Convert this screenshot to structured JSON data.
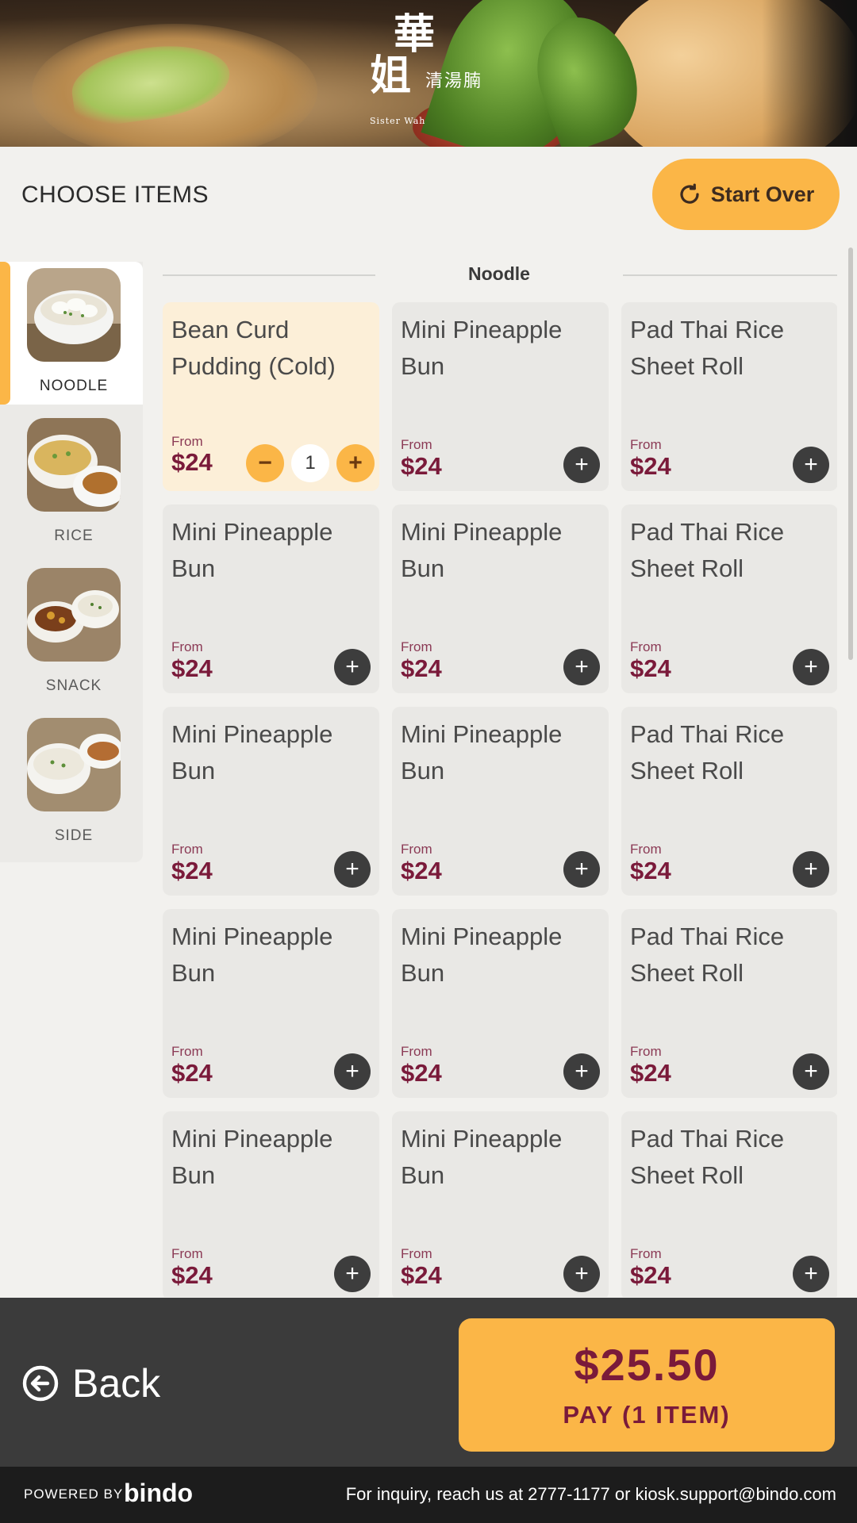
{
  "brand": {
    "logo_chars_top": "華",
    "logo_chars_bottom": "姐",
    "logo_subtitle": "清湯腩",
    "logo_english": "Sister Wah"
  },
  "header": {
    "title": "CHOOSE ITEMS",
    "start_over_label": "Start Over"
  },
  "sidebar": {
    "active_index": 0,
    "items": [
      {
        "label": "NOODLE",
        "image": "noodle-thumbnail"
      },
      {
        "label": "RICE",
        "image": "rice-thumbnail"
      },
      {
        "label": "SNACK",
        "image": "snack-thumbnail"
      },
      {
        "label": "SIDE",
        "image": "side-thumbnail"
      }
    ]
  },
  "menu": {
    "section_title": "Noodle",
    "from_label": "From",
    "items": [
      {
        "name": "Bean Curd Pudding (Cold)",
        "price": "$24",
        "quantity": "1",
        "selected": true
      },
      {
        "name": "Mini Pineapple Bun",
        "price": "$24"
      },
      {
        "name": "Pad Thai Rice Sheet Roll",
        "price": "$24"
      },
      {
        "name": "Mini Pineapple Bun",
        "price": "$24"
      },
      {
        "name": "Mini Pineapple Bun",
        "price": "$24"
      },
      {
        "name": "Pad Thai Rice Sheet Roll",
        "price": "$24"
      },
      {
        "name": "Mini Pineapple Bun",
        "price": "$24"
      },
      {
        "name": "Mini Pineapple Bun",
        "price": "$24"
      },
      {
        "name": "Pad Thai Rice Sheet Roll",
        "price": "$24"
      },
      {
        "name": "Mini Pineapple Bun",
        "price": "$24"
      },
      {
        "name": "Mini Pineapple Bun",
        "price": "$24"
      },
      {
        "name": "Pad Thai Rice Sheet Roll",
        "price": "$24"
      },
      {
        "name": "Mini Pineapple Bun",
        "price": "$24"
      },
      {
        "name": "Mini Pineapple Bun",
        "price": "$24"
      },
      {
        "name": "Pad Thai Rice Sheet Roll",
        "price": "$24"
      }
    ]
  },
  "footer_bar": {
    "back_label": "Back",
    "pay_amount": "$25.50",
    "pay_label": "PAY (1 ITEM)"
  },
  "footer": {
    "powered_by": "POWERED BY",
    "brand": "bindo",
    "inquiry": "For inquiry, reach us at 2777-1177 or  kiosk.support@bindo.com"
  },
  "colors": {
    "accent": "#fbb647",
    "price": "#7a1a3a",
    "selected_card": "#fcefd8",
    "dark_bar": "#3b3b3b"
  }
}
